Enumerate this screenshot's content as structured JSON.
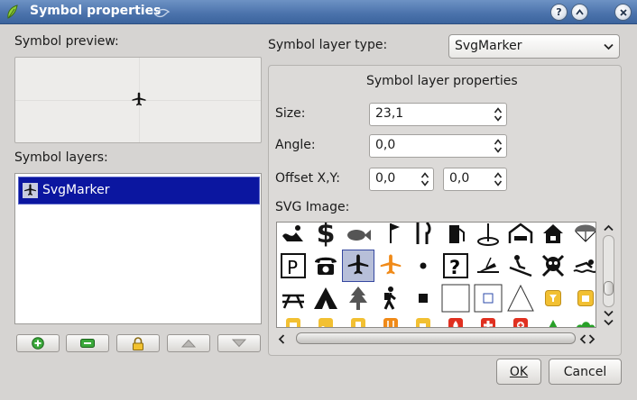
{
  "window": {
    "title": "Symbol properties",
    "help_label": "?"
  },
  "left": {
    "preview_label": "Symbol preview:",
    "layers_label": "Symbol layers:",
    "layers": [
      {
        "name": "SvgMarker",
        "icon": "airplane-icon"
      }
    ],
    "buttons": [
      {
        "name": "add-layer-button",
        "icon": "plus-icon"
      },
      {
        "name": "remove-layer-button",
        "icon": "minus-icon"
      },
      {
        "name": "lock-layer-button",
        "icon": "lock-icon"
      },
      {
        "name": "move-up-button",
        "icon": "arrow-up-icon"
      },
      {
        "name": "move-down-button",
        "icon": "arrow-down-icon"
      }
    ]
  },
  "right": {
    "layer_type_label": "Symbol layer type:",
    "layer_type_value": "SvgMarker",
    "group_title": "Symbol layer properties",
    "size_label": "Size:",
    "size_value": "23,1",
    "angle_label": "Angle:",
    "angle_value": "0,0",
    "offset_label": "Offset X,Y:",
    "offset_x": "0,0",
    "offset_y": "0,0",
    "svg_label": "SVG Image:",
    "svg_icons": [
      [
        "swimming-icon",
        "dollar-icon",
        "fish-icon",
        "golf-flag-icon",
        "restaurant-icon",
        "fuel-icon",
        "golf-hole-icon",
        "hostel-icon",
        "house-icon",
        "parachute-icon"
      ],
      [
        "parking-icon",
        "telephone-icon",
        "airplane-icon",
        "airport-orange-icon",
        "dot-icon",
        "question-icon",
        "shipwreck-icon",
        "skiing-icon",
        "skull-icon",
        "swimmer-icon"
      ],
      [
        "picnic-icon",
        "tent-icon",
        "tree-icon",
        "hiker-icon",
        "square-small-icon",
        "square-outline-icon",
        "square-small-outline-icon",
        "triangle-outline-icon",
        "beer-icon",
        "shop-icon"
      ],
      [
        "accommodation-icon",
        "rss-icon",
        "fast-food-icon",
        "restaurant-orange-icon",
        "cafe-icon",
        "fire-icon",
        "hospital-icon",
        "first-aid-icon",
        "peak-icon",
        "bush-icon"
      ]
    ],
    "selected_icon": "airplane-icon"
  },
  "footer": {
    "ok_label": "OK",
    "cancel_label": "Cancel"
  },
  "colors": {
    "selection": "#0b16a0",
    "orange": "#f08a18",
    "red": "#e03020",
    "green": "#28a028",
    "titlebar": "#4a72ab"
  }
}
